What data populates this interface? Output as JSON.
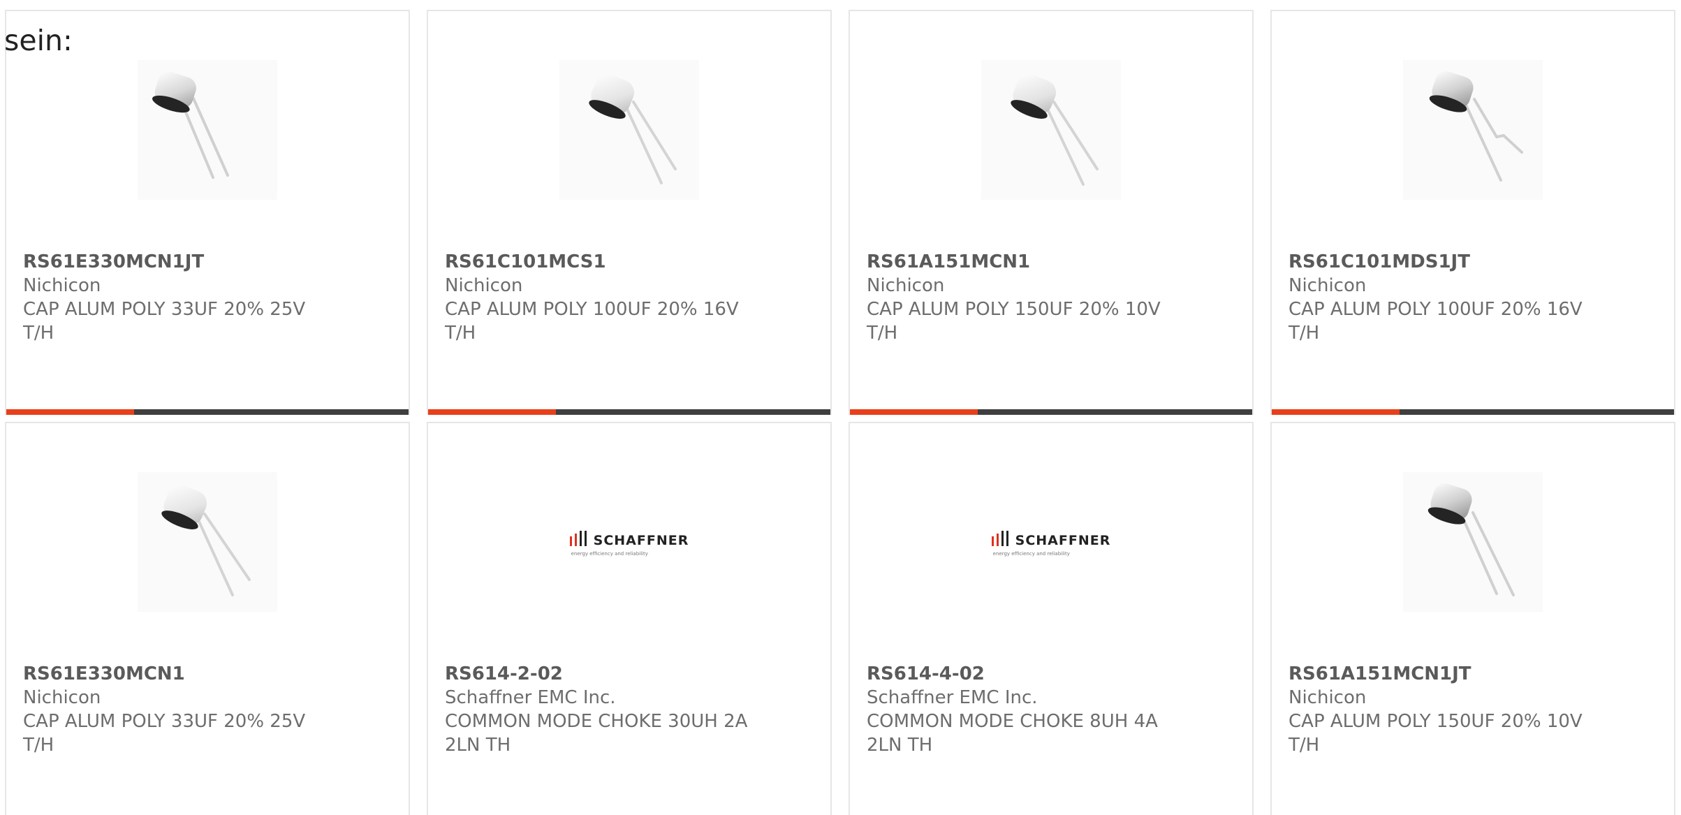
{
  "intro_text": "sein:",
  "products": [
    {
      "part": "RS61E330MCN1JT",
      "manufacturer": "Nichicon",
      "description": "CAP ALUM POLY 33UF 20% 25V T/H",
      "image": "capacitor-image"
    },
    {
      "part": "RS61C101MCS1",
      "manufacturer": "Nichicon",
      "description": "CAP ALUM POLY 100UF 20% 16V T/H",
      "image": "capacitor-image"
    },
    {
      "part": "RS61A151MCN1",
      "manufacturer": "Nichicon",
      "description": "CAP ALUM POLY 150UF 20% 10V T/H",
      "image": "capacitor-image"
    },
    {
      "part": "RS61C101MDS1JT",
      "manufacturer": "Nichicon",
      "description": "CAP ALUM POLY 100UF 20% 16V T/H",
      "image": "capacitor-image"
    },
    {
      "part": "RS61E330MCN1",
      "manufacturer": "Nichicon",
      "description": "CAP ALUM POLY 33UF 20% 25V T/H",
      "image": "capacitor-image"
    },
    {
      "part": "RS614-2-02",
      "manufacturer": "Schaffner EMC Inc.",
      "description": "COMMON MODE CHOKE 30UH 2A 2LN TH",
      "image": "schaffner-logo",
      "logo_text": "schaffner",
      "logo_tagline": "energy efficiency and reliability"
    },
    {
      "part": "RS614-4-02",
      "manufacturer": "Schaffner EMC Inc.",
      "description": "COMMON MODE CHOKE 8UH 4A 2LN TH",
      "image": "schaffner-logo",
      "logo_text": "schaffner",
      "logo_tagline": "energy efficiency and reliability"
    },
    {
      "part": "RS61A151MCN1JT",
      "manufacturer": "Nichicon",
      "description": "CAP ALUM POLY 150UF 20% 10V T/H",
      "image": "capacitor-image"
    }
  ],
  "colors": {
    "accent": "#e8401c",
    "bar": "#3f3f3f",
    "border": "#e6e6e6",
    "text": "#6d6d6d"
  }
}
